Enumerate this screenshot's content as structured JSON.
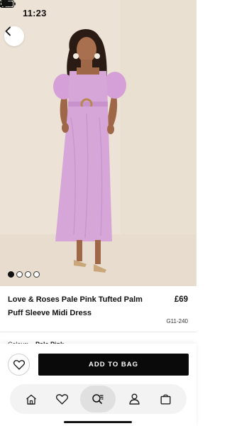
{
  "status_bar": {
    "time": "11:23",
    "icons": [
      "signal-icon",
      "wifi-icon",
      "battery-icon"
    ]
  },
  "hero": {
    "image_alt": "woman-in-pink-midi-dress",
    "dots": {
      "count": 4,
      "active_index": 0
    }
  },
  "product": {
    "title": "Love & Roses Pale Pink Tufted Palm Puff Sleeve Midi Dress",
    "price": "£69",
    "sku": "G11-240",
    "colour_label": "Colour:",
    "colour_value": "Pale Pink"
  },
  "actions": {
    "wishlist_icon": "heart-outline-icon",
    "add_to_bag_label": "ADD TO BAG"
  },
  "nav": {
    "items": [
      {
        "name": "home",
        "icon": "home-icon"
      },
      {
        "name": "favourites",
        "icon": "heart-icon"
      },
      {
        "name": "visual-search",
        "icon": "visual-search-icon",
        "active": true
      },
      {
        "name": "account",
        "icon": "person-icon"
      },
      {
        "name": "bag",
        "icon": "shopping-bag-icon"
      }
    ]
  },
  "colors": {
    "accent": "#0a0a0a",
    "dress": "#d7a6d9",
    "background_wall": "#eadfd1"
  }
}
